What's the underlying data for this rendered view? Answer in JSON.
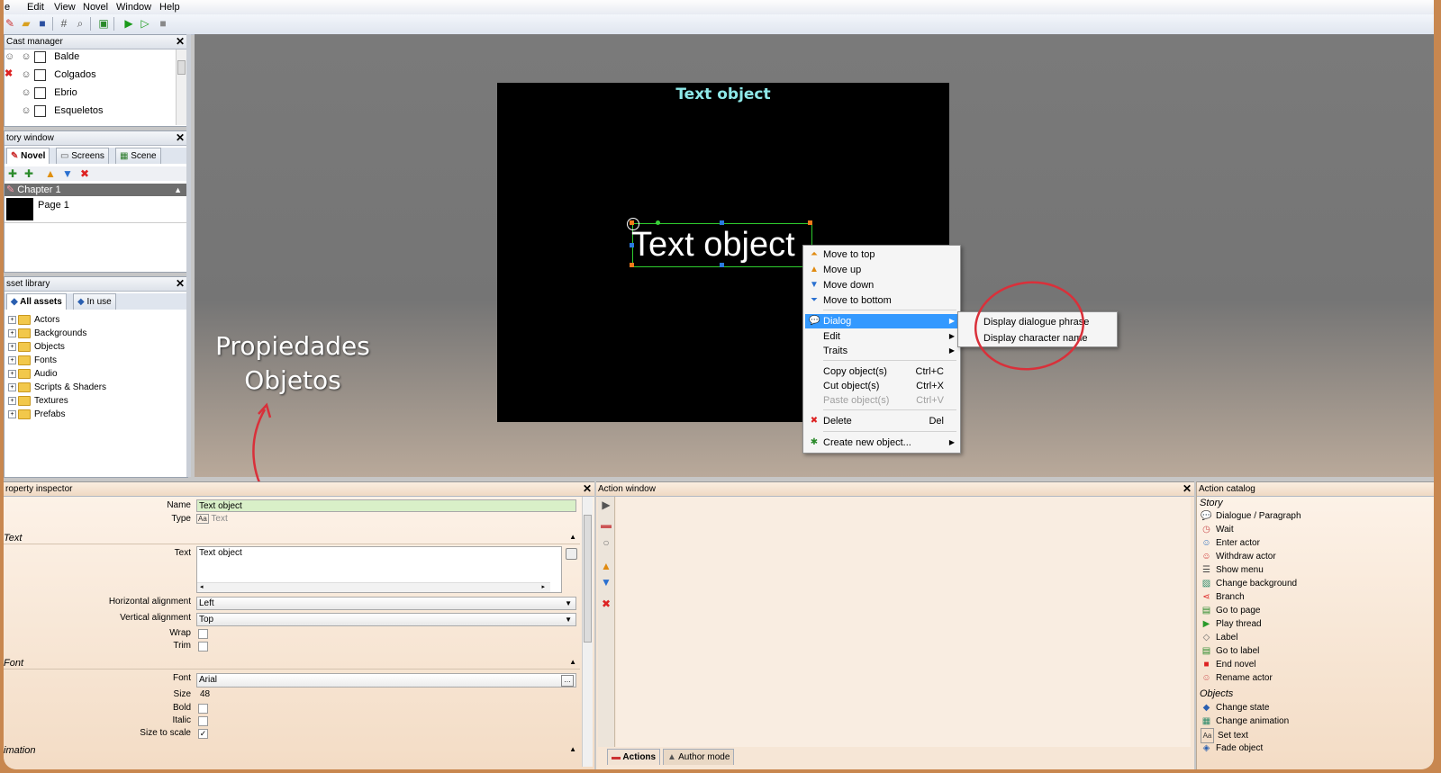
{
  "menubar": {
    "items": [
      "e",
      "Edit",
      "View",
      "Novel",
      "Window",
      "Help"
    ]
  },
  "cast_manager": {
    "title": "Cast manager",
    "items": [
      "Balde",
      "Colgados",
      "Ebrio",
      "Esqueletos"
    ]
  },
  "story_window": {
    "title": "tory window",
    "tabs": [
      "Novel",
      "Screens",
      "Scene"
    ],
    "chapter": "Chapter 1",
    "page": "Page 1"
  },
  "asset_library": {
    "title": "sset library",
    "tabs": [
      "All assets",
      "In use"
    ],
    "items": [
      "Actors",
      "Backgrounds",
      "Objects",
      "Fonts",
      "Audio",
      "Scripts & Shaders",
      "Textures",
      "Prefabs"
    ]
  },
  "stage": {
    "title": "Text object",
    "object_text": "Text object"
  },
  "context_menu": {
    "order": [
      "Move to top",
      "Move up",
      "Move down",
      "Move to bottom"
    ],
    "dialog": "Dialog",
    "edit": "Edit",
    "traits": "Traits",
    "copy": {
      "label": "Copy object(s)",
      "shortcut": "Ctrl+C"
    },
    "cut": {
      "label": "Cut object(s)",
      "shortcut": "Ctrl+X"
    },
    "paste": {
      "label": "Paste object(s)",
      "shortcut": "Ctrl+V"
    },
    "delete": {
      "label": "Delete",
      "shortcut": "Del"
    },
    "create": "Create new object..."
  },
  "submenu": {
    "items": [
      "Display dialogue phrase",
      "Display character name"
    ]
  },
  "annotation": {
    "line1": "Propiedades",
    "line2": "Objetos",
    "color": "#d9303a"
  },
  "property_inspector": {
    "title": "roperty inspector",
    "name_label": "Name",
    "name_value": "Text object",
    "type_label": "Type",
    "type_value": "Text",
    "section_text": "Text",
    "text_label": "Text",
    "text_value": "Text object",
    "halign_label": "Horizontal alignment",
    "halign_value": "Left",
    "valign_label": "Vertical alignment",
    "valign_value": "Top",
    "wrap_label": "Wrap",
    "trim_label": "Trim",
    "section_font": "Font",
    "font_label": "Font",
    "font_value": "Arial",
    "size_label": "Size",
    "size_value": "48",
    "bold_label": "Bold",
    "italic_label": "Italic",
    "scale_label": "Size to scale",
    "section_anim": "imation"
  },
  "action_window": {
    "title": "Action window",
    "tabs": [
      "Actions",
      "Author mode"
    ]
  },
  "action_catalog": {
    "title": "Action catalog",
    "section_story": "Story",
    "story": [
      "Dialogue / Paragraph",
      "Wait",
      "Enter actor",
      "Withdraw actor",
      "Show menu",
      "Change background",
      "Branch",
      "Go to page",
      "Play thread",
      "Label",
      "Go to label",
      "End novel",
      "Rename actor"
    ],
    "section_objects": "Objects",
    "objects": [
      "Change state",
      "Change animation",
      "Set text",
      "Fade object"
    ]
  },
  "colors": {
    "accent_blue": "#3399ff",
    "stage_title": "#8ee8e8",
    "frame_orange": "#c8874f"
  }
}
